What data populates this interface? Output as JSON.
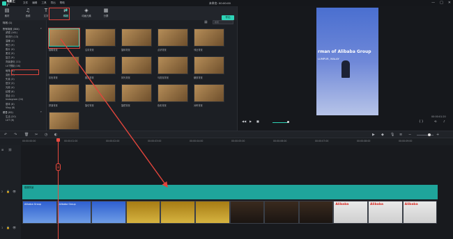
{
  "titlebar": {
    "app_name": "喵影工厂",
    "menus": [
      "文件",
      "编辑",
      "工具",
      "导出",
      "帮助"
    ],
    "doc_title": "未命名: 00:00:00",
    "controls": [
      "—",
      "□",
      "✕"
    ]
  },
  "tabs": [
    {
      "label": "素材",
      "icon": "▤"
    },
    {
      "label": "音频",
      "icon": "♫"
    },
    {
      "label": "文字",
      "icon": "T"
    },
    {
      "label": "转场",
      "icon": "⇄"
    },
    {
      "label": "特效",
      "icon": "✦"
    },
    {
      "label": "动画元素",
      "icon": "◈"
    },
    {
      "label": "分屏",
      "icon": "▦"
    }
  ],
  "export_label": "导出",
  "sidebar": {
    "header": "特效 (1)",
    "categories": [
      {
        "label": "所有特效 (304)",
        "top": true
      },
      {
        "label": "滤镜 (161)"
      },
      {
        "label": "常流行 (13)"
      },
      {
        "label": "温暖 (4)"
      },
      {
        "label": "黑白 (9)"
      },
      {
        "label": "胶片 (4)"
      },
      {
        "label": "柔光 (9)"
      },
      {
        "label": "复古 (9)"
      },
      {
        "label": "背景虚化 (11)"
      },
      {
        "label": "LUT预制 (16)"
      },
      {
        "label": "暗角 (8)"
      },
      {
        "label": "变形 (7)"
      },
      {
        "label": "失真 (3)"
      },
      {
        "label": "层次 (3)"
      },
      {
        "label": "光效 (4)"
      },
      {
        "label": "纹理 (8)"
      },
      {
        "label": "混合 (1)"
      },
      {
        "label": "Instagram (24)"
      },
      {
        "label": "基本 (8)"
      },
      {
        "label": "Vlog (8)"
      },
      {
        "label": "覆叠 (92)",
        "top": true
      },
      {
        "label": "生活 (20)"
      },
      {
        "label": "LUT (8)"
      }
    ]
  },
  "grid": {
    "search_placeholder": "搜索",
    "items": [
      "模糊背景",
      "沿向背景",
      "旋转背景",
      "点状背景",
      "邻近背景",
      "灰色背景",
      "图案背景",
      "抹光背景",
      "马赛克背景",
      "缩放背景",
      "拼凑背景",
      "旋切背景",
      "旋镜背景",
      "色彩背景",
      "对称背景",
      "方块背景"
    ]
  },
  "preview": {
    "video_line1": "rman of Alibaba Group",
    "video_line2": "LUMPUR, MALAY",
    "timecode": "00:00:01:20",
    "controls": [
      "◀◀",
      "▶",
      "■",
      "{ }",
      "⟲",
      "♪"
    ]
  },
  "ruler": [
    "00:00:00:00",
    "00:00:01:00",
    "00:00:02:00",
    "00:00:03:00",
    "00:00:04:00",
    "00:00:05:00",
    "00:00:06:00",
    "00:00:07:00",
    "00:00:08:00",
    "00:00:09:00"
  ],
  "timeline": {
    "effect_clip_label": "模糊背景",
    "track_labels": [
      "1",
      "2"
    ],
    "clips": [
      {
        "style": "v-blue",
        "text": "Alibaba Group"
      },
      {
        "style": "v-blue",
        "text": "Alibaba Group"
      },
      {
        "style": "v-blue",
        "text": ""
      },
      {
        "style": "v-gold",
        "text": ""
      },
      {
        "style": "v-gold",
        "text": ""
      },
      {
        "style": "v-gold",
        "text": ""
      },
      {
        "style": "v-dark",
        "text": ""
      },
      {
        "style": "v-dark",
        "text": ""
      },
      {
        "style": "v-dark",
        "text": ""
      },
      {
        "style": "v-white",
        "text": "Alibaba"
      },
      {
        "style": "v-white",
        "text": "Alibaba"
      },
      {
        "style": "v-white",
        "text": "Alibaba"
      }
    ]
  },
  "colors": {
    "accent": "#2ed3b7",
    "annotation": "#e2453c"
  }
}
